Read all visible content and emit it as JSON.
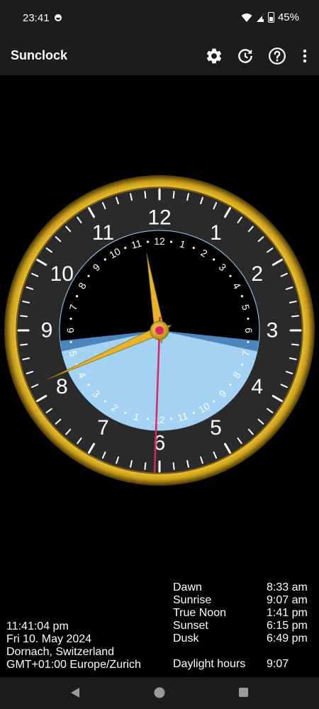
{
  "status_bar": {
    "time": "23:41",
    "battery": "45%"
  },
  "app_bar": {
    "title": "Sunclock",
    "icons": [
      "settings-icon",
      "history-icon",
      "help-icon",
      "more-vert-icon"
    ]
  },
  "clock": {
    "outer_numerals": [
      "12",
      "1",
      "2",
      "3",
      "4",
      "5",
      "6",
      "7",
      "8",
      "9",
      "10",
      "11"
    ],
    "inner_numerals": [
      "1",
      "2",
      "3",
      "4",
      "5",
      "6",
      "7",
      "8",
      "9",
      "10",
      "11",
      "12",
      "1",
      "2",
      "3",
      "4",
      "5",
      "6",
      "7",
      "8",
      "9",
      "10",
      "11",
      "12"
    ],
    "time": {
      "hours": 11,
      "minutes": 41,
      "seconds": 4
    },
    "colors": {
      "rim": "#e5b523",
      "face": "#2a2a2a",
      "night": "#000000",
      "day": "#a3d2f2",
      "twilight": "#4c86bf",
      "hands": "#e6b428",
      "second_hand": "#e0245e"
    }
  },
  "info_left": {
    "time": "11:41:04 pm",
    "date": "Fri 10. May 2024",
    "location": "Dornach, Switzerland",
    "timezone": "GMT+01:00 Europe/Zurich"
  },
  "info_right": {
    "rows": [
      {
        "label": "Dawn",
        "value": "8:33 am"
      },
      {
        "label": "Sunrise",
        "value": "9:07 am"
      },
      {
        "label": "True Noon",
        "value": "1:41 pm"
      },
      {
        "label": "Sunset",
        "value": "6:15 pm"
      },
      {
        "label": "Dusk",
        "value": "6:49 pm"
      }
    ],
    "daylight_label": "Daylight hours",
    "daylight_value": "9:07"
  }
}
